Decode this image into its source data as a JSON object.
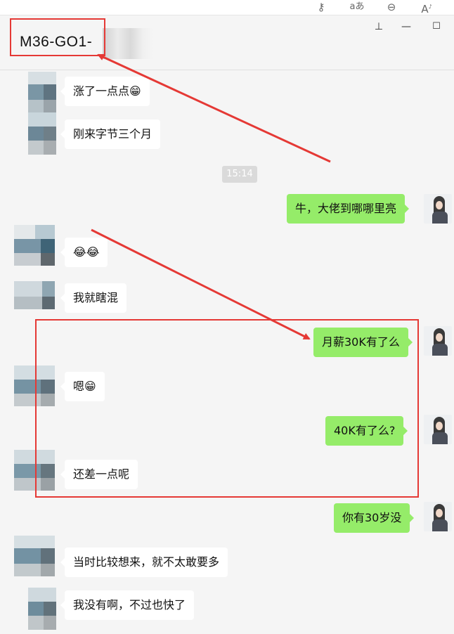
{
  "toolbar": {
    "icons": [
      "key-icon",
      "translate-icon",
      "zoom-out-icon",
      "read-aloud-icon"
    ],
    "key_glyph": "⚷",
    "translate_glyph": "aあ",
    "zoom_glyph": "⊖",
    "read_glyph": "A",
    "read_sup": "♪"
  },
  "window": {
    "title": "M36-GO1-",
    "pin_glyph": "⊥",
    "min_glyph": "—",
    "max_glyph": "☐"
  },
  "messages": [
    {
      "dir": "in",
      "text": "涨了一点点😁"
    },
    {
      "dir": "in",
      "text": "刚来字节三个月"
    },
    {
      "dir": "time",
      "text": "15:14"
    },
    {
      "dir": "out",
      "text": "牛，大佬到哪哪里亮"
    },
    {
      "dir": "in",
      "text": "😂😂"
    },
    {
      "dir": "in",
      "text": "我就瞎混"
    },
    {
      "dir": "out",
      "text": "月薪30K有了么"
    },
    {
      "dir": "in",
      "text": "嗯😁"
    },
    {
      "dir": "out",
      "text": "40K有了么?"
    },
    {
      "dir": "in",
      "text": "还差一点呢"
    },
    {
      "dir": "out",
      "text": "你有30岁没"
    },
    {
      "dir": "in",
      "text": "当时比较想来，就不太敢要多"
    },
    {
      "dir": "in",
      "text": "我没有啊，不过也快了"
    }
  ],
  "colors": {
    "outgoing_bubble": "#95ec69",
    "incoming_bubble": "#ffffff",
    "annotation": "#e53935",
    "background": "#f5f5f5"
  }
}
